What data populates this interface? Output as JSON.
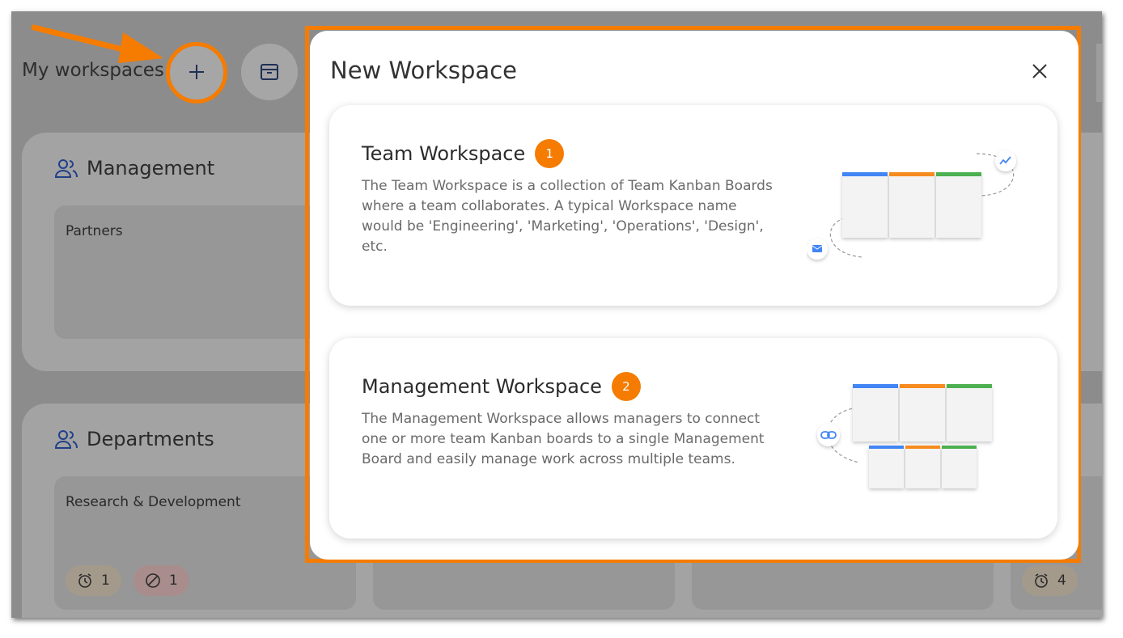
{
  "header": {
    "title": "My workspaces",
    "add_icon": "plus-icon",
    "archive_icon": "archive-box-icon"
  },
  "workspaces": [
    {
      "name": "Management",
      "icon": "people-icon",
      "boards": [
        {
          "name": "Partners"
        }
      ]
    },
    {
      "name": "Departments",
      "icon": "people-icon",
      "boards": [
        {
          "name": "Research & Development",
          "badges": [
            {
              "icon": "alarm-clock-icon",
              "count": "1"
            },
            {
              "icon": "blocked-icon",
              "count": "1"
            }
          ]
        },
        {
          "name": ""
        },
        {
          "name": ""
        },
        {
          "name": "",
          "badges": [
            {
              "icon": "alarm-clock-icon",
              "count": "4"
            }
          ]
        }
      ]
    }
  ],
  "modal": {
    "title": "New Workspace",
    "close_icon": "close-icon",
    "options": [
      {
        "title": "Team Workspace",
        "badge": "1",
        "description": "The Team Workspace is a collection of Team Kanban Boards where a team collaborates. A typical Workspace name would be 'Engineering', 'Marketing', 'Operations', 'Design', etc.",
        "illustration_icons": [
          "trend-chart-icon",
          "envelope-icon"
        ]
      },
      {
        "title": "Management Workspace",
        "badge": "2",
        "description": "The Management Workspace allows managers to connect one or more team Kanban boards to a single Management Board and easily manage work across multiple teams.",
        "illustration_icons": [
          "link-icon"
        ]
      }
    ]
  },
  "colors": {
    "accent": "#f57c00",
    "overlay": "#8c8c8c",
    "column_blue": "#4285f4",
    "column_orange": "#f68b1f",
    "column_green": "#4caf50",
    "icon_navy": "#1f2f55"
  }
}
